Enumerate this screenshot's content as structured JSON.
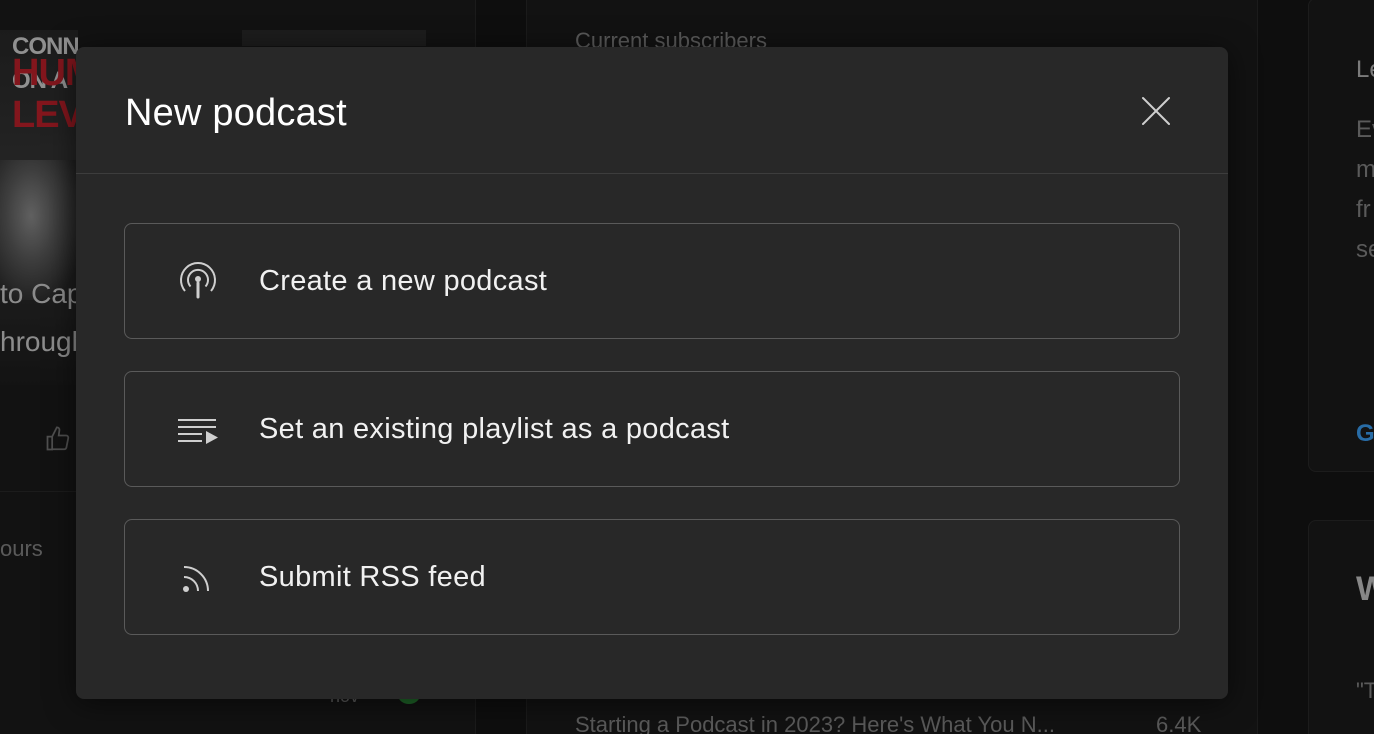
{
  "background": {
    "thumbnail_lines": [
      "CONNECT ON A",
      "HUM",
      "LEV"
    ],
    "thumbnail_captions": [
      "to Cap",
      "hrough"
    ],
    "left_text": "ours",
    "left_status": "nov",
    "subscribers_heading": "Current subscribers",
    "video_title": "Starting a Podcast in 2023? Here's What You N...",
    "video_views": "6.4K",
    "right_heading": "Le",
    "right_lines": [
      "Ev",
      "m",
      "fr",
      "se"
    ],
    "right_link": "G",
    "right_card_heading": "W",
    "right_quote": "\"T"
  },
  "modal": {
    "title": "New podcast",
    "options": [
      {
        "label": "Create a new podcast",
        "icon": "podcast-icon"
      },
      {
        "label": "Set an existing playlist as a podcast",
        "icon": "playlist-play-icon"
      },
      {
        "label": "Submit RSS feed",
        "icon": "rss-feed-icon"
      }
    ]
  },
  "colors": {
    "modal_bg": "#282828",
    "page_bg": "#161616",
    "option_border": "#5a5a5a",
    "text": "#f1f1f1",
    "accent_link": "#3ea6ff"
  }
}
